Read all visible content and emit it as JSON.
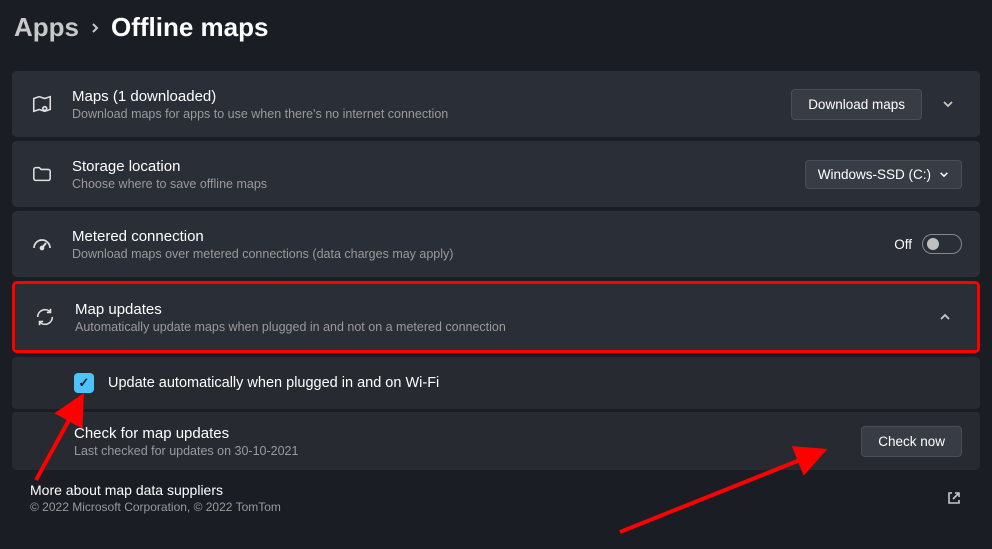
{
  "breadcrumb": {
    "parent": "Apps",
    "current": "Offline maps"
  },
  "rows": {
    "maps": {
      "title": "Maps (1 downloaded)",
      "subtitle": "Download maps for apps to use when there's no internet connection",
      "button": "Download maps"
    },
    "storage": {
      "title": "Storage location",
      "subtitle": "Choose where to save offline maps",
      "dropdown_value": "Windows-SSD (C:)"
    },
    "metered": {
      "title": "Metered connection",
      "subtitle": "Download maps over metered connections (data charges may apply)",
      "toggle_label": "Off"
    },
    "updates": {
      "title": "Map updates",
      "subtitle": "Automatically update maps when plugged in and not on a metered connection"
    },
    "auto_update": {
      "label": "Update automatically when plugged in and on Wi-Fi"
    },
    "check": {
      "title": "Check for map updates",
      "subtitle": "Last checked for updates on 30-10-2021",
      "button": "Check now"
    }
  },
  "footer": {
    "title": "More about map data suppliers",
    "copyright": "© 2022 Microsoft Corporation, © 2022 TomTom"
  }
}
